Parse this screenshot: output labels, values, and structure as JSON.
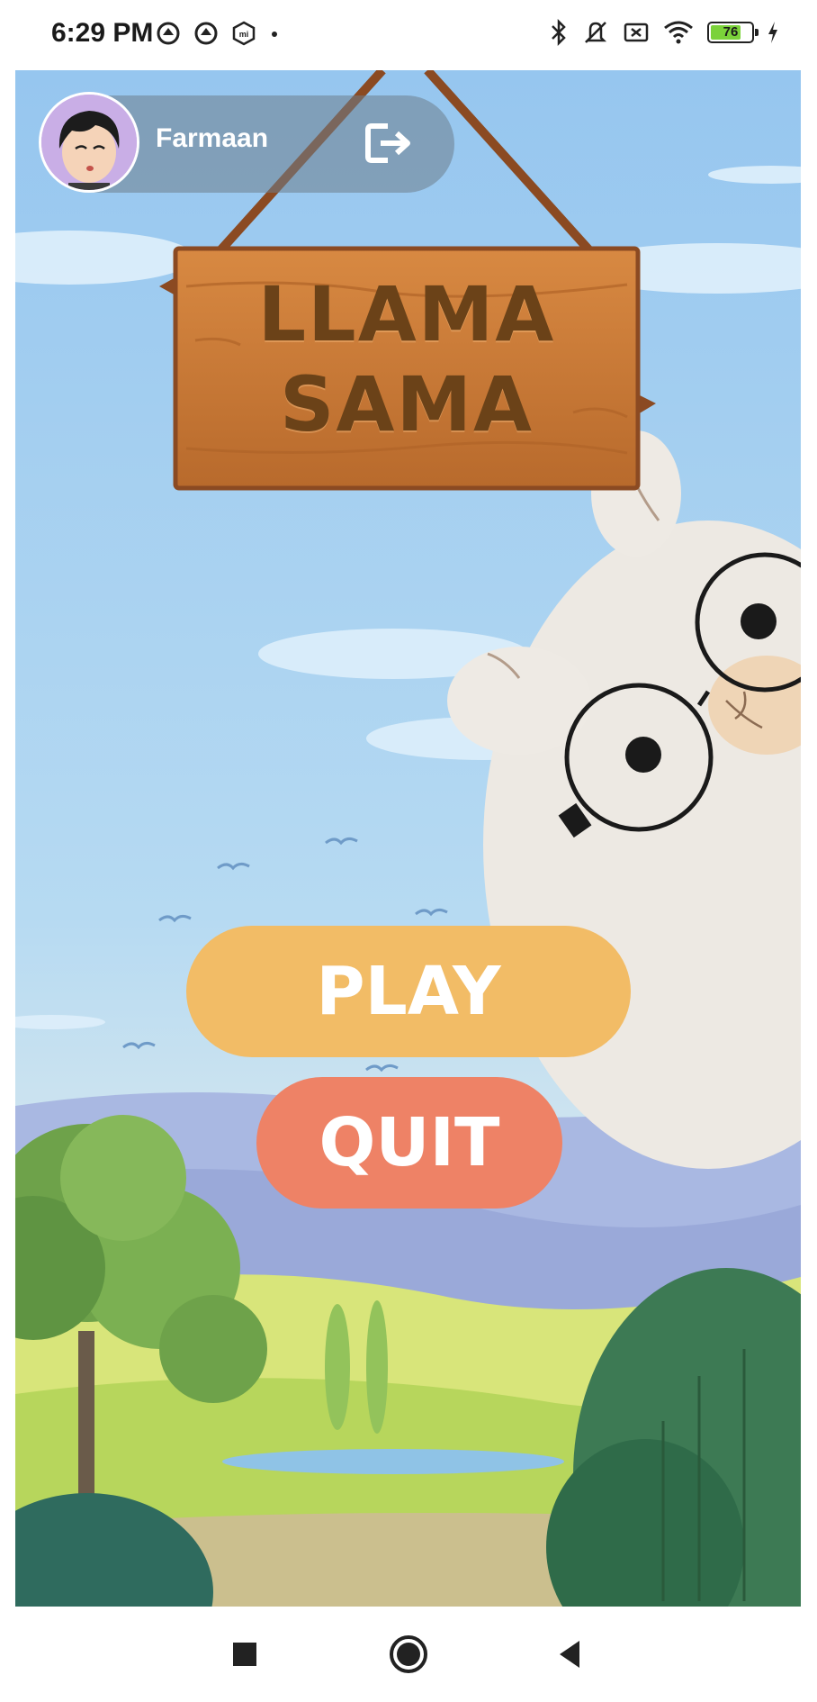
{
  "status_bar": {
    "time": "6:29 PM",
    "battery_level": "76",
    "battery_percent": 76
  },
  "profile": {
    "username": "Farmaan"
  },
  "game": {
    "title_line1": "LLAMA",
    "title_line2": "SAMA",
    "play_label": "PLAY",
    "quit_label": "QUIT"
  },
  "colors": {
    "play_button": "#f2bc66",
    "quit_button": "#ee8266",
    "sky": "#9cc9ee",
    "sign_wood": "#c97a3a"
  },
  "icons": [
    "bluetooth-icon",
    "vibrate-off-icon",
    "sim-off-icon",
    "wifi-icon",
    "battery-icon",
    "charging-icon",
    "logout-icon",
    "stop-nav-icon",
    "home-nav-icon",
    "back-nav-icon"
  ]
}
